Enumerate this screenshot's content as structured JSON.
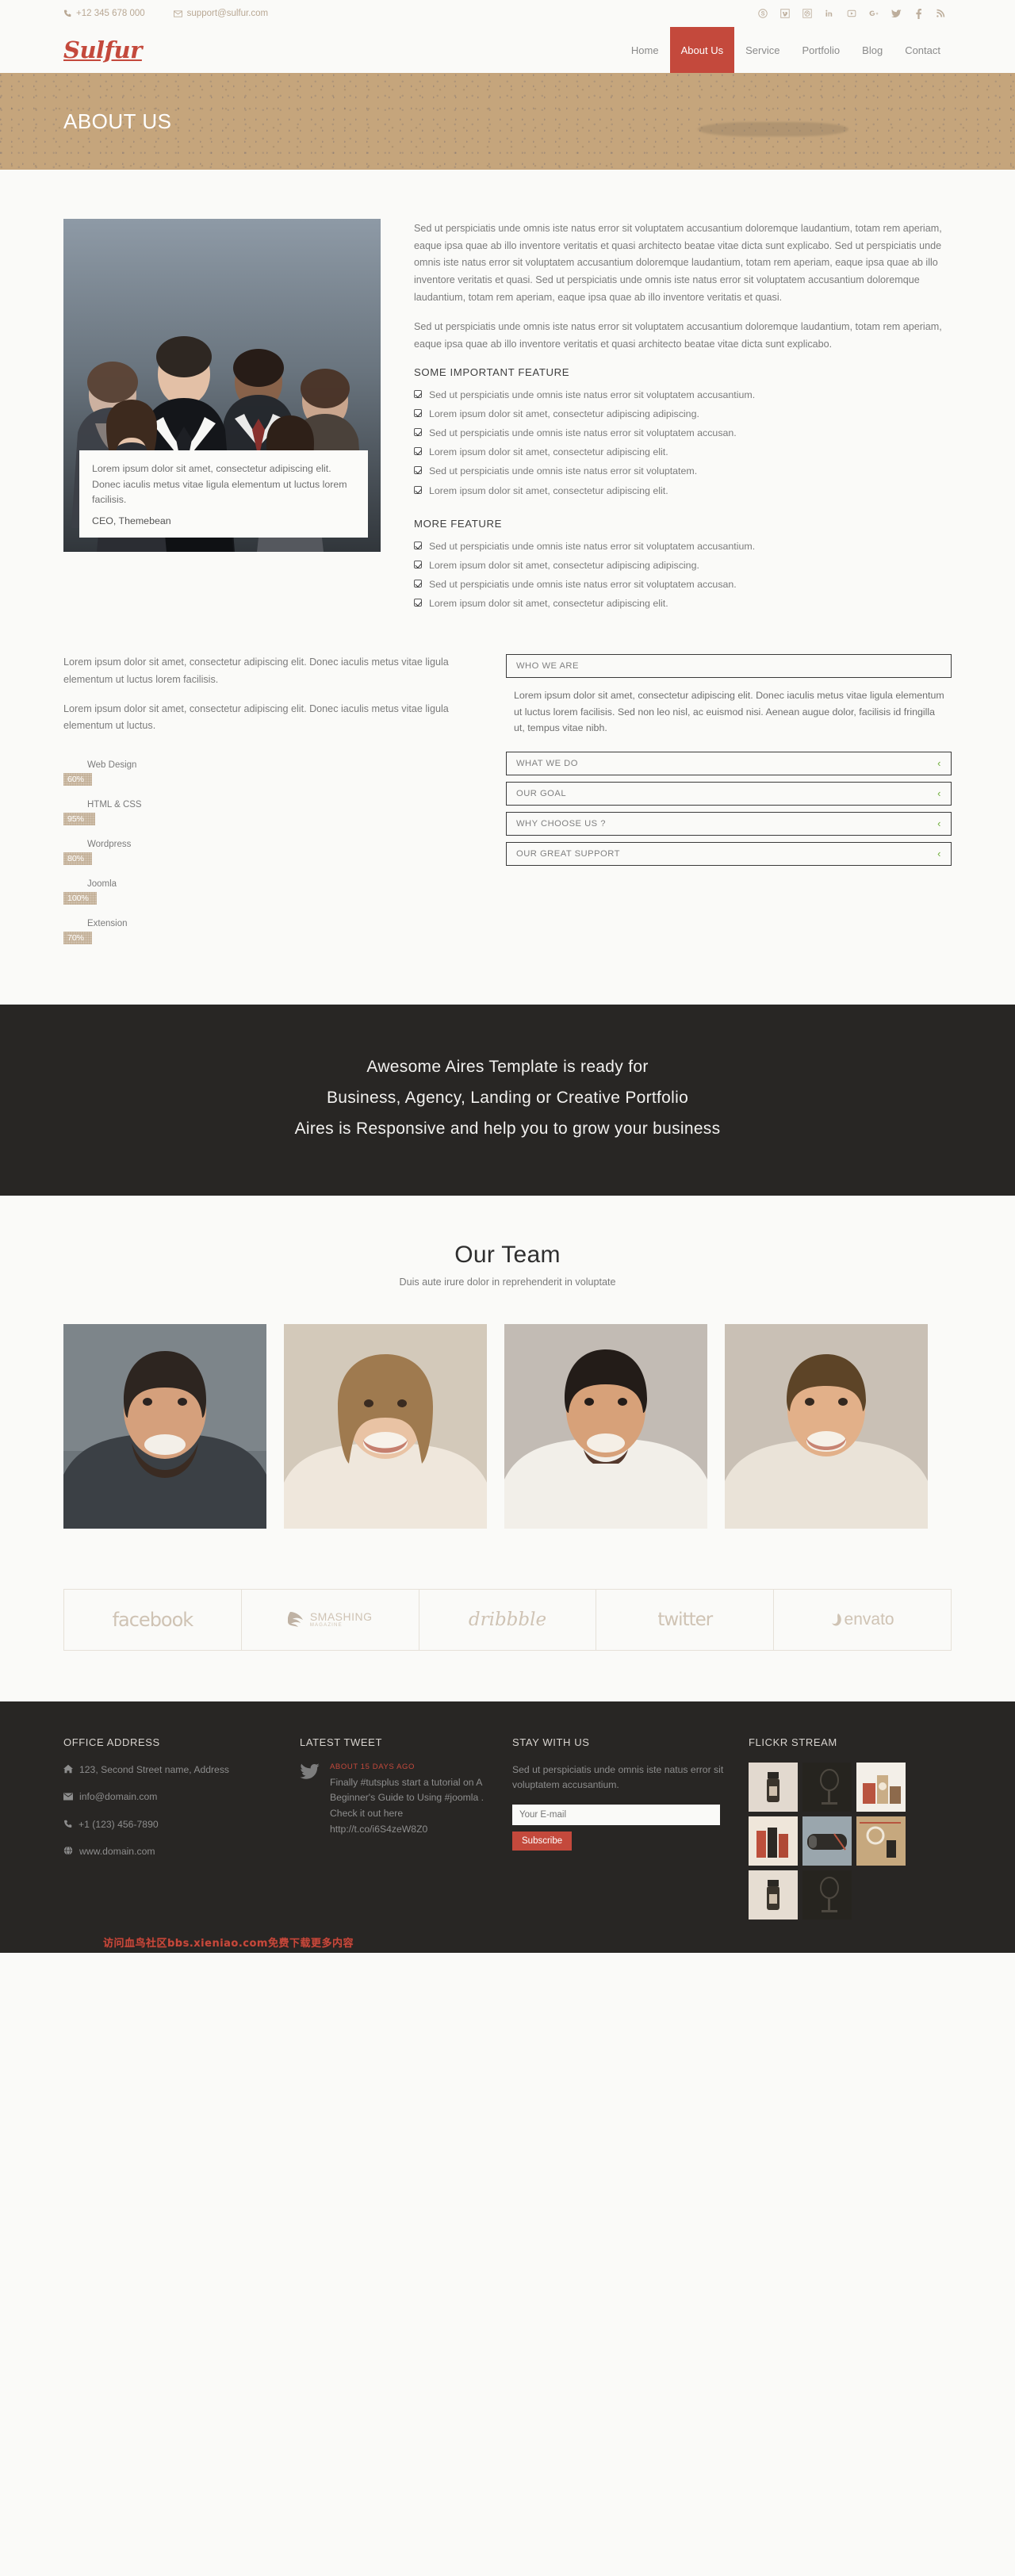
{
  "topbar": {
    "phone": "+12 345 678 000",
    "email": "support@sulfur.com",
    "phone_icon": "phone-icon",
    "email_icon": "envelope-icon",
    "socials": [
      {
        "name": "skype-icon",
        "glyph": "S"
      },
      {
        "name": "vimeo-icon",
        "glyph": "V"
      },
      {
        "name": "dribbble-icon",
        "glyph": "⌗"
      },
      {
        "name": "linkedin-icon",
        "glyph": "in"
      },
      {
        "name": "youtube-icon",
        "glyph": "▶"
      },
      {
        "name": "googleplus-icon",
        "glyph": "g+"
      },
      {
        "name": "twitter-icon",
        "glyph": "ᵗ"
      },
      {
        "name": "facebook-icon",
        "glyph": "f"
      },
      {
        "name": "rss-icon",
        "glyph": "≋"
      }
    ]
  },
  "header": {
    "logo": "Sulfur",
    "nav": [
      {
        "label": "Home",
        "active": false
      },
      {
        "label": "About Us",
        "active": true
      },
      {
        "label": "Service",
        "active": false
      },
      {
        "label": "Portfolio",
        "active": false
      },
      {
        "label": "Blog",
        "active": false
      },
      {
        "label": "Contact",
        "active": false
      }
    ]
  },
  "banner": {
    "title": "ABOUT US",
    "bg_color": "#c5a57c"
  },
  "about": {
    "quote": "Lorem ipsum dolor sit amet, consectetur adipiscing elit. Donec iaculis metus vitae ligula elementum ut luctus lorem facilisis.",
    "quote_by": "CEO, Themebean",
    "paragraphs": [
      "Sed ut perspiciatis unde omnis iste natus error sit voluptatem accusantium doloremque laudantium, totam rem aperiam, eaque ipsa quae ab illo inventore veritatis et quasi architecto beatae vitae dicta sunt explicabo. Sed ut perspiciatis unde omnis iste natus error sit voluptatem accusantium doloremque laudantium, totam rem aperiam, eaque ipsa quae ab illo inventore veritatis et quasi. Sed ut perspiciatis unde omnis iste natus error sit voluptatem accusantium doloremque laudantium, totam rem aperiam, eaque ipsa quae ab illo inventore veritatis et quasi.",
      "Sed ut perspiciatis unde omnis iste natus error sit voluptatem accusantium doloremque laudantium, totam rem aperiam, eaque ipsa quae ab illo inventore veritatis et quasi architecto beatae vitae dicta sunt explicabo."
    ],
    "feature_title_1": "SOME IMPORTANT FEATURE",
    "features_1": [
      "Sed ut perspiciatis unde omnis iste natus error sit voluptatem accusantium.",
      "Lorem ipsum dolor sit amet, consectetur adipiscing adipiscing.",
      "Sed ut perspiciatis unde omnis iste natus error sit voluptatem accusan.",
      "Lorem ipsum dolor sit amet, consectetur adipiscing elit.",
      "Sed ut perspiciatis unde omnis iste natus error sit voluptatem.",
      "Lorem ipsum dolor sit amet, consectetur adipiscing elit."
    ],
    "feature_title_2": "MORE FEATURE",
    "features_2": [
      "Sed ut perspiciatis unde omnis iste natus error sit voluptatem accusantium.",
      "Lorem ipsum dolor sit amet, consectetur adipiscing adipiscing.",
      "Sed ut perspiciatis unde omnis iste natus error sit voluptatem accusan.",
      "Lorem ipsum dolor sit amet, consectetur adipiscing elit."
    ]
  },
  "mid": {
    "paragraphs": [
      "Lorem ipsum dolor sit amet, consectetur adipiscing elit. Donec iaculis metus vitae ligula elementum ut luctus lorem facilisis.",
      "Lorem ipsum dolor sit amet, consectetur adipiscing elit. Donec iaculis metus vitae ligula elementum ut luctus."
    ],
    "skills": [
      {
        "name": "Web Design",
        "value": 60,
        "label": "60%"
      },
      {
        "name": "HTML & CSS",
        "value": 95,
        "label": "95%"
      },
      {
        "name": "Wordpress",
        "value": 80,
        "label": "80%"
      },
      {
        "name": "Joomla",
        "value": 100,
        "label": "100%"
      },
      {
        "name": "Extension",
        "value": 70,
        "label": "70%"
      }
    ],
    "accordion": [
      {
        "label": "WHO WE ARE",
        "open": true,
        "body": "Lorem ipsum dolor sit amet, consectetur adipiscing elit. Donec iaculis metus vitae ligula elementum ut luctus lorem facilisis. Sed non leo nisl, ac euismod nisi. Aenean augue dolor, facilisis id fringilla ut, tempus vitae nibh.",
        "chevron": ""
      },
      {
        "label": "WHAT WE DO",
        "open": false,
        "body": "",
        "chevron": "‹"
      },
      {
        "label": "OUR GOAL",
        "open": false,
        "body": "",
        "chevron": "‹"
      },
      {
        "label": "WHY CHOOSE US ?",
        "open": false,
        "body": "",
        "chevron": "‹"
      },
      {
        "label": "OUR GREAT SUPPORT",
        "open": false,
        "body": "",
        "chevron": "‹"
      }
    ]
  },
  "cta": {
    "line1": "Awesome Aires Template is ready for",
    "line2": "Business, Agency, Landing or Creative Portfolio",
    "line3": "Aires is Responsive and help you to grow your business"
  },
  "team": {
    "title": "Our Team",
    "subtitle": "Duis aute irure dolor in reprehenderit in voluptate",
    "members": [
      "member-photo-1",
      "member-photo-2",
      "member-photo-3",
      "member-photo-4"
    ]
  },
  "brands": [
    {
      "name": "facebook-logo",
      "text": "facebook"
    },
    {
      "name": "smashing-magazine-logo",
      "text": "SMASHING",
      "sub": "MAGAZINE"
    },
    {
      "name": "dribbble-logo",
      "text": "dribbble"
    },
    {
      "name": "twitter-logo",
      "text": "twitter"
    },
    {
      "name": "envato-logo",
      "text": "envato"
    }
  ],
  "footer": {
    "col1_title": "OFFICE ADDRESS",
    "address": "123, Second Street name, Address",
    "email": "info@domain.com",
    "phone": "+1 (123) 456-7890",
    "website": "www.domain.com",
    "col2_title": "LATEST TWEET",
    "tweet_when": "ABOUT 15 DAYS AGO",
    "tweet_text": "Finally #tutsplus start a tutorial on A Beginner's Guide to Using #joomla . Check it out here http://t.co/i6S4zeW8Z0",
    "col3_title": "STAY WITH US",
    "stay_text": "Sed ut perspiciatis unde omnis iste natus error sit voluptatem accusantium.",
    "mail_placeholder": "Your E-mail",
    "subscribe_label": "Subscribe",
    "col4_title": "FLICKR STREAM",
    "watermark": "访问血鸟社区bbs.xieniao.com免费下载更多内容"
  },
  "colors": {
    "accent_red": "#c4493c",
    "banner_tan": "#c5a57c",
    "dark": "#282624",
    "green": "#6fae3a"
  }
}
